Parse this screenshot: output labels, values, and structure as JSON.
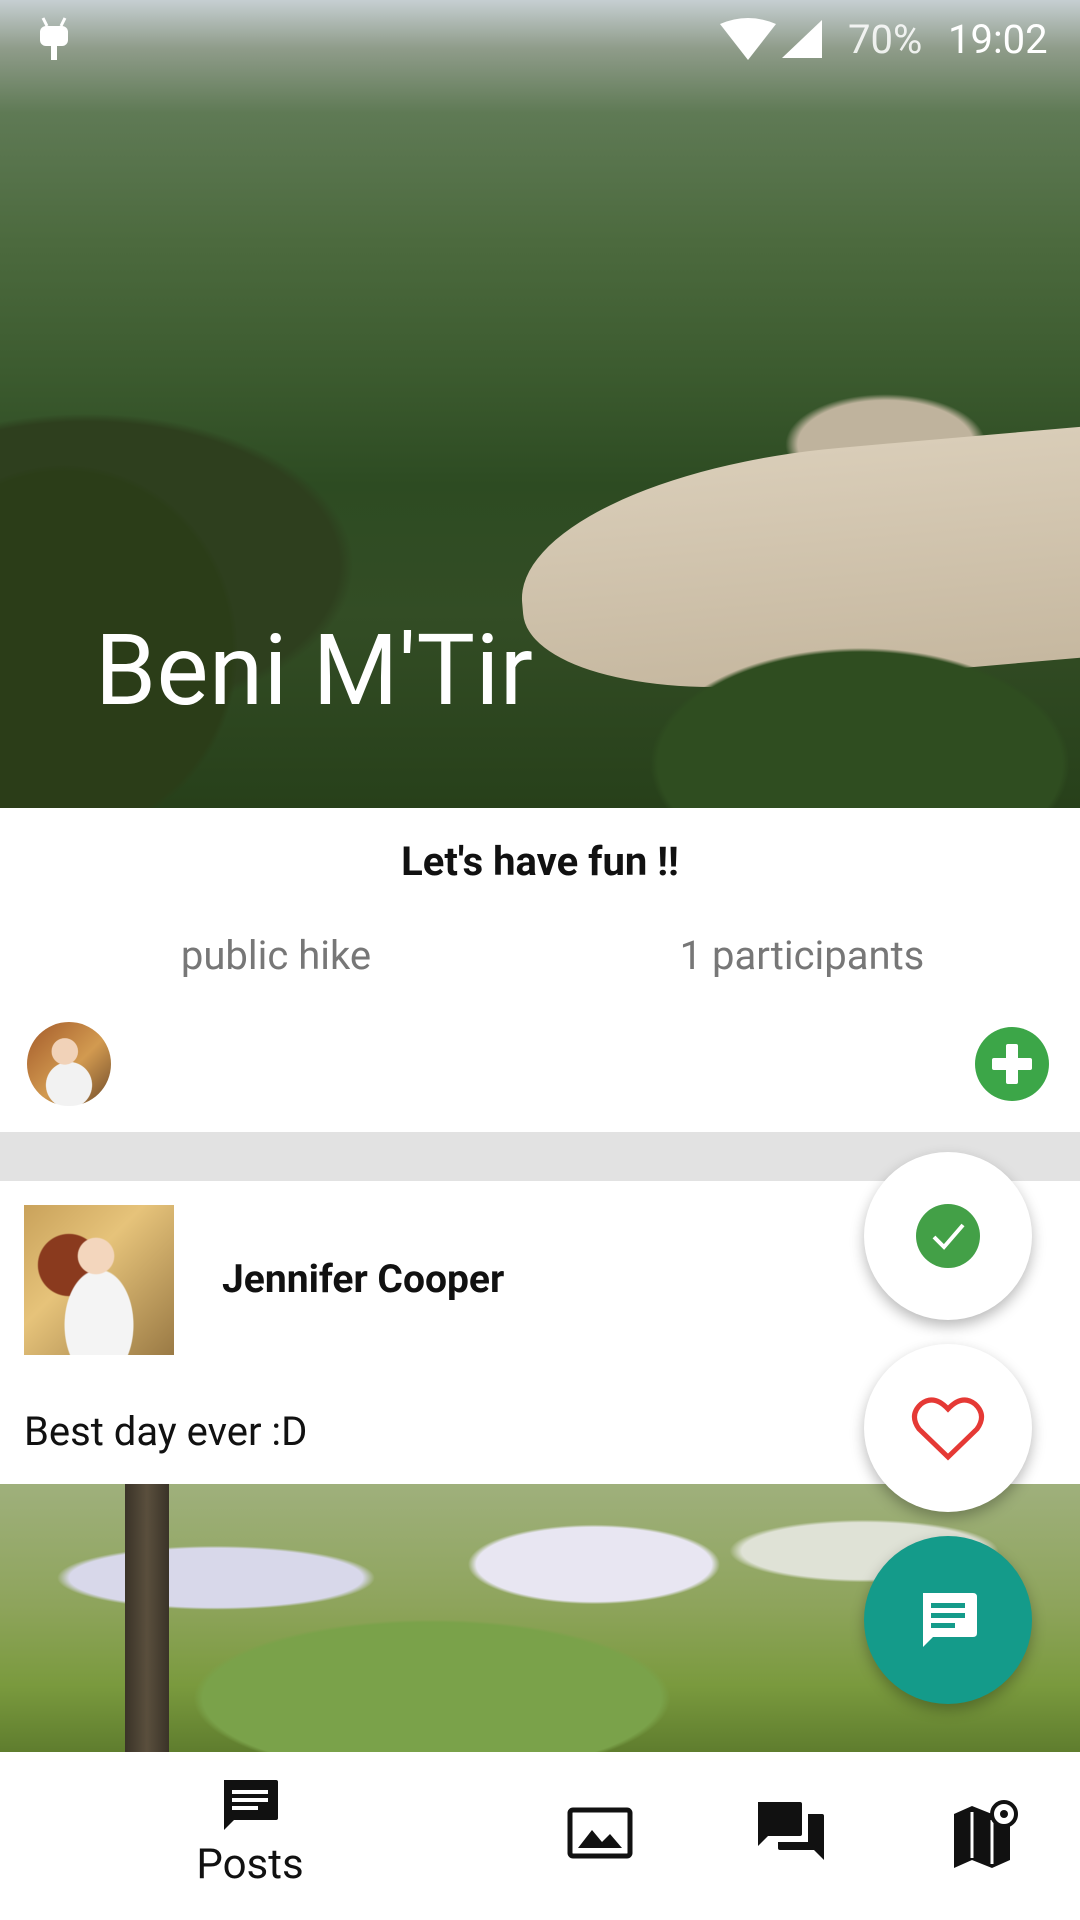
{
  "status_bar": {
    "battery": "70%",
    "time": "19:02",
    "icons": [
      "android-icon",
      "wifi-icon",
      "signal-icon"
    ]
  },
  "event": {
    "title": "Beni M'Tir",
    "slogan": "Let's have fun !!",
    "type": "public hike",
    "participants": "1 participants"
  },
  "post": {
    "author": "Jennifer Cooper",
    "text": "Best day ever :D"
  },
  "fabs": [
    "check-circle-icon",
    "heart-icon",
    "comment-icon"
  ],
  "colors": {
    "accent_green": "#3ca648",
    "teal": "#149b8a",
    "heart_red": "#e53935",
    "divider": "#e2e2e2"
  },
  "bottom_nav": {
    "posts_label": "Posts",
    "icons": [
      "posts-icon",
      "gallery-icon",
      "chat-icon",
      "map-icon"
    ]
  }
}
